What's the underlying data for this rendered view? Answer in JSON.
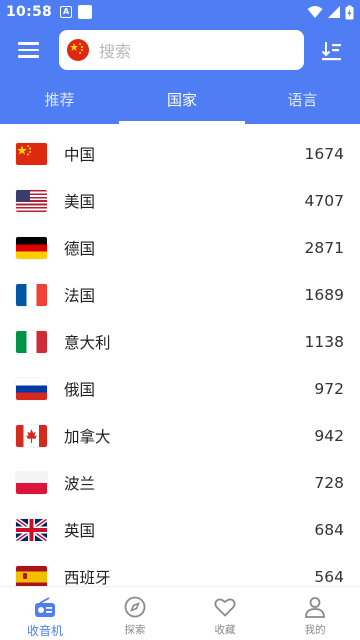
{
  "status_bar": {
    "time": "10:58",
    "notif_letter": "A"
  },
  "search": {
    "placeholder": "搜索"
  },
  "tabs": [
    {
      "label": "推荐"
    },
    {
      "label": "国家"
    },
    {
      "label": "语言"
    }
  ],
  "active_tab": "国家",
  "countries": [
    {
      "name": "中国",
      "count": "1674",
      "flag": "cn"
    },
    {
      "name": "美国",
      "count": "4707",
      "flag": "us"
    },
    {
      "name": "德国",
      "count": "2871",
      "flag": "de"
    },
    {
      "name": "法国",
      "count": "1689",
      "flag": "fr"
    },
    {
      "name": "意大利",
      "count": "1138",
      "flag": "it"
    },
    {
      "name": "俄国",
      "count": "972",
      "flag": "ru"
    },
    {
      "name": "加拿大",
      "count": "942",
      "flag": "ca"
    },
    {
      "name": "波兰",
      "count": "728",
      "flag": "pl"
    },
    {
      "name": "英国",
      "count": "684",
      "flag": "gb"
    },
    {
      "name": "西班牙",
      "count": "564",
      "flag": "es"
    }
  ],
  "bottom_nav": [
    {
      "label": "收音机",
      "icon": "radio-icon",
      "active": true
    },
    {
      "label": "探索",
      "icon": "compass-icon",
      "active": false
    },
    {
      "label": "收藏",
      "icon": "heart-icon",
      "active": false
    },
    {
      "label": "我的",
      "icon": "person-icon",
      "active": false
    }
  ],
  "colors": {
    "primary": "#4f7df3",
    "active_nav": "#4f7df3",
    "inactive_nav": "#8a8a8a"
  }
}
